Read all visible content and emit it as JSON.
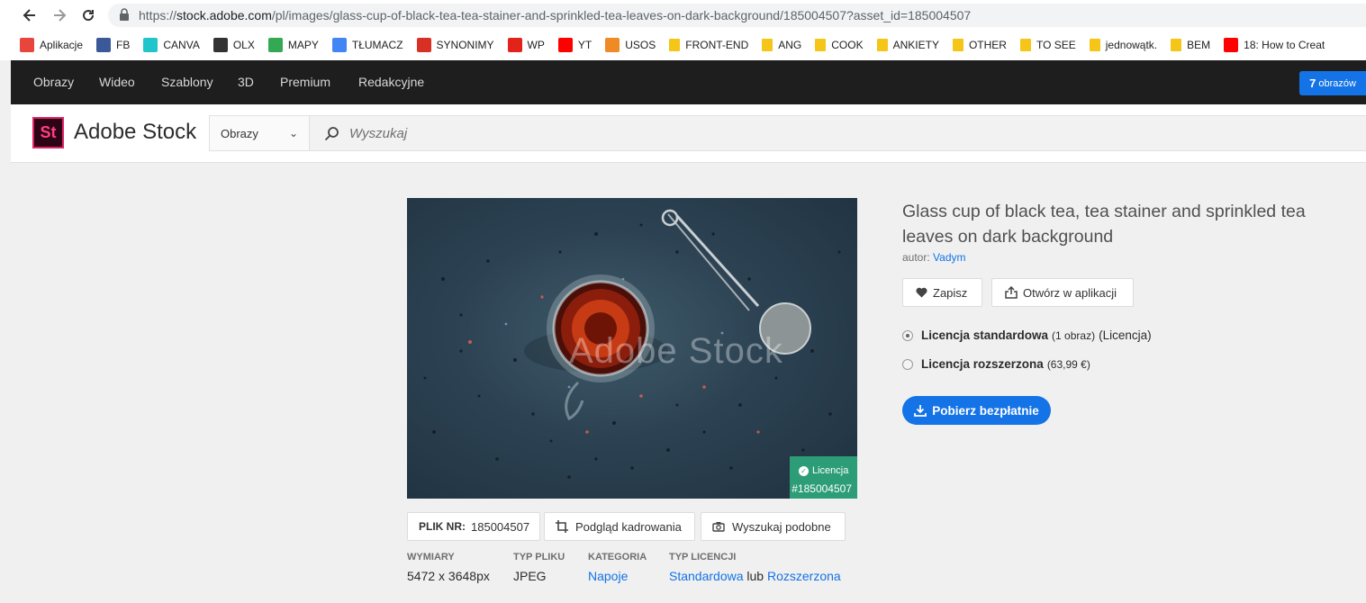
{
  "browser": {
    "url_prefix": "https://",
    "url_host": "stock.adobe.com",
    "url_path": "/pl/images/glass-cup-of-black-tea-tea-stainer-and-sprinkled-tea-leaves-on-dark-background/185004507?asset_id=185004507",
    "bookmarks": [
      {
        "label": "Aplikacje",
        "icon": "apps-grid-icon",
        "color": "#e8453c"
      },
      {
        "label": "FB",
        "icon": "facebook-icon",
        "color": "#3b5998"
      },
      {
        "label": "CANVA",
        "icon": "canva-icon",
        "color": "#20c4cb"
      },
      {
        "label": "OLX",
        "icon": "olx-icon",
        "color": "#333333"
      },
      {
        "label": "MAPY",
        "icon": "maps-icon",
        "color": "#34a853"
      },
      {
        "label": "TŁUMACZ",
        "icon": "translate-icon",
        "color": "#4285f4"
      },
      {
        "label": "SYNONIMY",
        "icon": "synonimy-icon",
        "color": "#d93025"
      },
      {
        "label": "WP",
        "icon": "wp-icon",
        "color": "#e2231a"
      },
      {
        "label": "YT",
        "icon": "youtube-icon",
        "color": "#ff0000"
      },
      {
        "label": "USOS",
        "icon": "usos-icon",
        "color": "#f08a24"
      },
      {
        "label": "FRONT-END",
        "icon": "folder-icon",
        "color": "#f5c518"
      },
      {
        "label": "ANG",
        "icon": "folder-icon",
        "color": "#f5c518"
      },
      {
        "label": "COOK",
        "icon": "folder-icon",
        "color": "#f5c518"
      },
      {
        "label": "ANKIETY",
        "icon": "folder-icon",
        "color": "#f5c518"
      },
      {
        "label": "OTHER",
        "icon": "folder-icon",
        "color": "#f5c518"
      },
      {
        "label": "TO SEE",
        "icon": "folder-icon",
        "color": "#f5c518"
      },
      {
        "label": "jednowątk.",
        "icon": "folder-icon",
        "color": "#f5c518"
      },
      {
        "label": "BEM",
        "icon": "folder-icon",
        "color": "#f5c518"
      },
      {
        "label": "18: How to Creat",
        "icon": "youtube-icon",
        "color": "#ff0000"
      }
    ]
  },
  "topnav": {
    "items": [
      "Obrazy",
      "Wideo",
      "Szablony",
      "3D",
      "Premium",
      "Redakcyjne"
    ],
    "count_number": "7",
    "count_label": "obrazów"
  },
  "header": {
    "brand": "Adobe Stock",
    "logo_text": "St",
    "type_select": "Obrazy",
    "search_placeholder": "Wyszukaj"
  },
  "asset": {
    "watermark": "Adobe Stock",
    "badge_label": "Licencja",
    "badge_id": "#185004507",
    "file_nr_label": "PLIK NR:",
    "file_nr": "185004507",
    "crop_preview": "Podgląd kadrowania",
    "find_similar": "Wyszukaj podobne",
    "meta": {
      "dims_label": "WYMIARY",
      "dims_value": "5472 x 3648px",
      "type_label": "TYP PLIKU",
      "type_value": "JPEG",
      "cat_label": "KATEGORIA",
      "cat_value": "Napoje",
      "lic_label": "TYP LICENCJI",
      "lic_standard": "Standardowa",
      "lic_or": "lub",
      "lic_extended": "Rozszerzona"
    },
    "title": "Glass cup of black tea, tea stainer and sprinkled tea leaves on dark background",
    "author_label": "autor:",
    "author_name": "Vadym",
    "save_label": "Zapisz",
    "open_app_label": "Otwórz w aplikacji",
    "license_standard_name": "Licencja standardowa",
    "license_standard_qty": "(1 obraz)",
    "license_standard_extra": "(Licencja)",
    "license_extended_name": "Licencja rozszerzona",
    "license_extended_price": "(63,99 €)",
    "download_label": "Pobierz bezpłatnie"
  },
  "colors": {
    "accent": "#1473e6",
    "badge": "#2d9d78",
    "darknav": "#1e1e1e"
  }
}
